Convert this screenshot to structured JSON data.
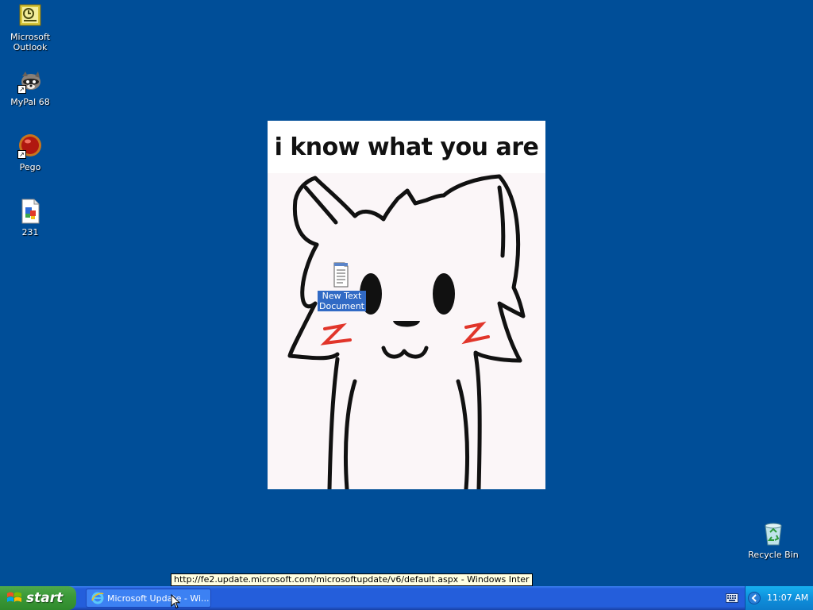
{
  "desktop": {
    "icons": [
      {
        "label_line1": "Microsoft",
        "label_line2": "Outlook"
      },
      {
        "label_line1": "MyPal 68",
        "label_line2": ""
      },
      {
        "label_line1": "Pego",
        "label_line2": ""
      },
      {
        "label_line1": "231",
        "label_line2": ""
      }
    ],
    "wallpaper_caption": "i know what you are",
    "selected_file": {
      "label_line1": "New Text",
      "label_line2": "Document"
    },
    "recycle_bin": "Recycle Bin"
  },
  "tooltip": "http://fe2.update.microsoft.com/microsoftupdate/v6/default.aspx - Windows Inter",
  "taskbar": {
    "start_label": "start",
    "task_label": "Microsoft Update - Wi...",
    "clock": "11:07 AM"
  },
  "colors": {
    "desktop_bg": "#004e98",
    "taskbar": "#245edb",
    "start_button": "#3c9a39",
    "tray": "#0f8fdb",
    "selection": "#316ac5",
    "blush": "#e1352a"
  }
}
